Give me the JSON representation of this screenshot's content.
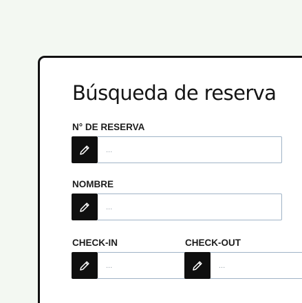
{
  "form": {
    "title": "Búsqueda de reserva",
    "fields": [
      {
        "label": "N° DE RESERVA",
        "placeholder": "...",
        "value": "",
        "icon": "pencil-icon"
      },
      {
        "label": "NOMBRE",
        "placeholder": "...",
        "value": "",
        "icon": "pencil-icon"
      },
      {
        "label": "CHECK-IN",
        "placeholder": "...",
        "value": "",
        "icon": "pencil-icon"
      },
      {
        "label": "CHECK-OUT",
        "placeholder": "...",
        "value": "",
        "icon": "pencil-icon"
      }
    ]
  },
  "colors": {
    "background": "#f3f8f2",
    "card": "#ffffff",
    "card_border": "#111111",
    "icon_button": "#0f0f0f",
    "input_border": "#9fb3c6"
  }
}
